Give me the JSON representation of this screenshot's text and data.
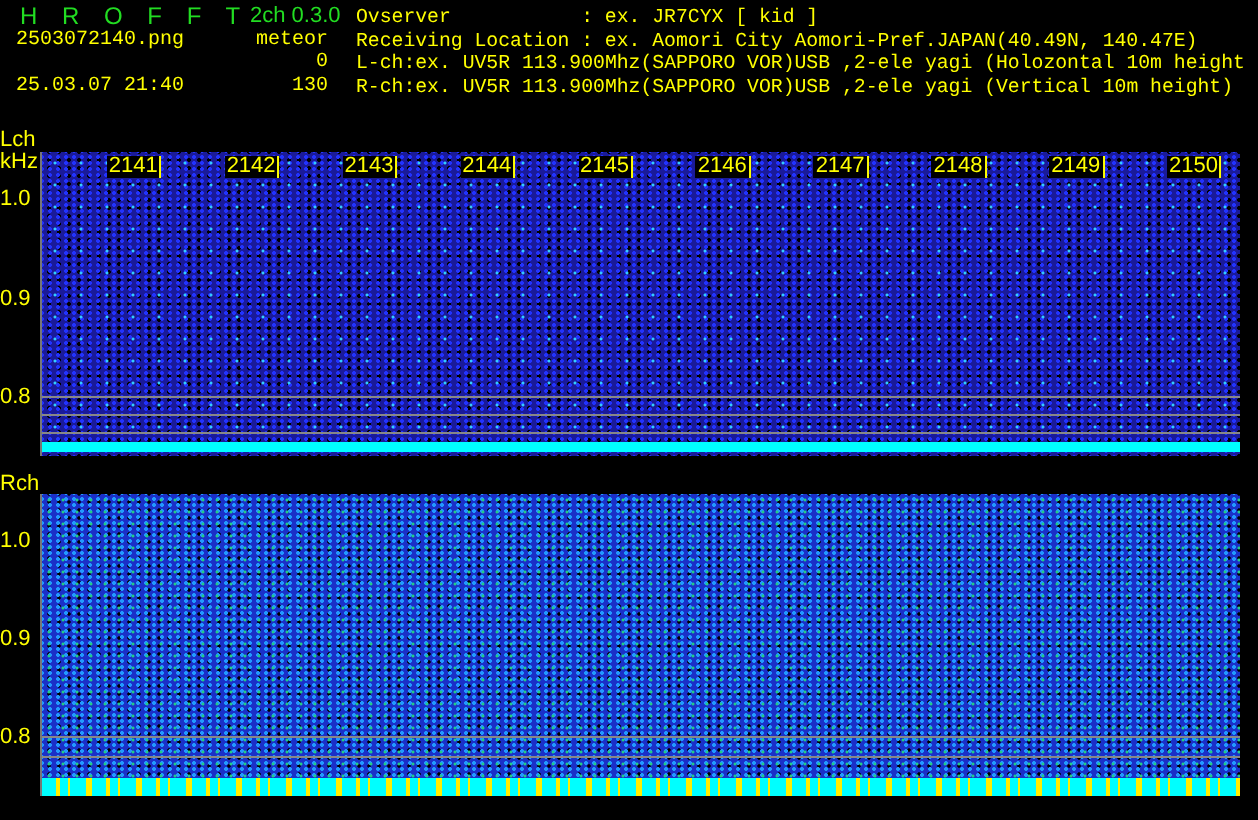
{
  "app": {
    "title": "H R O F F T",
    "version": "2ch 0.3.0",
    "file": "2503072140.png",
    "datetime": "25.03.07 21:40",
    "counter_label": "meteor",
    "counts": [
      "0",
      "130"
    ]
  },
  "info": [
    {
      "kind": "field",
      "label": "Ovserver",
      "value": ": ex. JR7CYX [ kid ]"
    },
    {
      "kind": "field",
      "label": "Receiving Location",
      "value": ": ex. Aomori City Aomori-Pref.JAPAN(40.49N, 140.47E)"
    },
    {
      "kind": "line",
      "text": "L-ch:ex. UV5R 113.900Mhz(SAPPORO VOR)USB ,2-ele yagi (Holozontal 10m height"
    },
    {
      "kind": "line",
      "text": "R-ch:ex. UV5R 113.900Mhz(SAPPORO VOR)USB ,2-ele yagi (Vertical 10m height)"
    }
  ],
  "panels": [
    {
      "label": "Lch",
      "unit": "kHz",
      "time_labels": [
        "2141",
        "2142",
        "2143",
        "2144",
        "2145",
        "2146",
        "2147",
        "2148",
        "2149",
        "2150"
      ],
      "y_labels": [
        "1.0",
        "0.9",
        "0.8"
      ]
    },
    {
      "label": "Rch",
      "y_labels": [
        "1.0",
        "0.9",
        "0.8"
      ]
    }
  ]
}
